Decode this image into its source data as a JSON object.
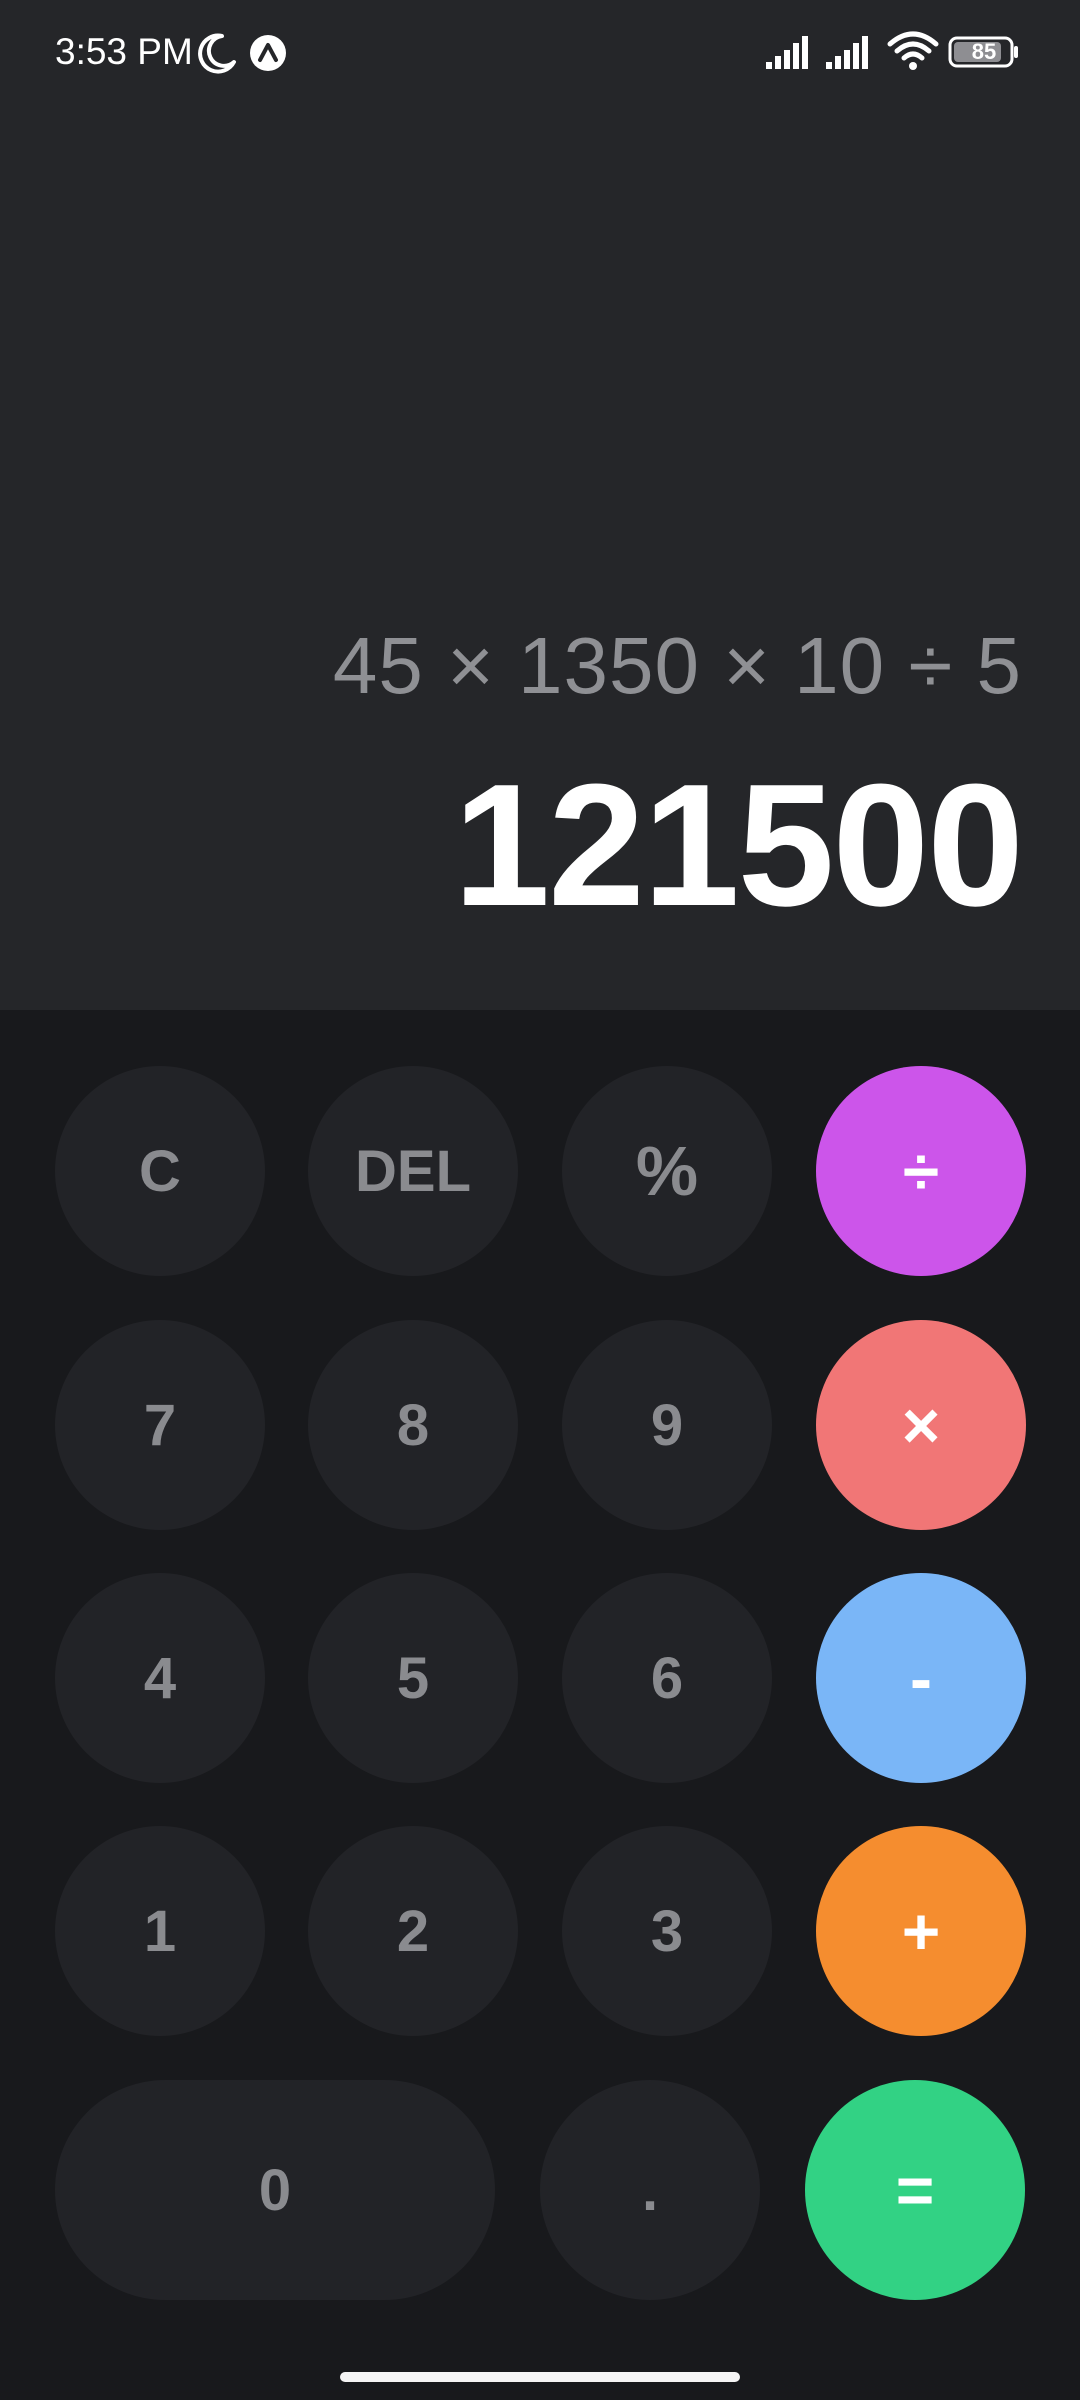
{
  "status_bar": {
    "time": "3:53 PM",
    "battery": "85",
    "icons": [
      "moon-icon",
      "app-badge-icon",
      "signal-icon",
      "signal-icon",
      "wifi-icon",
      "battery-icon"
    ]
  },
  "display": {
    "expression": "45 × 1350 × 10 ÷ 5",
    "result": "121500"
  },
  "keys": {
    "clear": "C",
    "delete": "DEL",
    "percent": "%",
    "divide": "÷",
    "seven": "7",
    "eight": "8",
    "nine": "9",
    "multiply": "×",
    "four": "4",
    "five": "5",
    "six": "6",
    "subtract": "-",
    "one": "1",
    "two": "2",
    "three": "3",
    "add": "+",
    "zero": "0",
    "decimal": ".",
    "equals": "="
  },
  "colors": {
    "display_bg": "#252629",
    "keypad_bg": "#18191c",
    "key_bg": "#222327",
    "divide": "#cc55ea",
    "multiply": "#f17676",
    "subtract": "#7ab6f7",
    "add": "#f58d2f",
    "equals": "#32d284"
  }
}
